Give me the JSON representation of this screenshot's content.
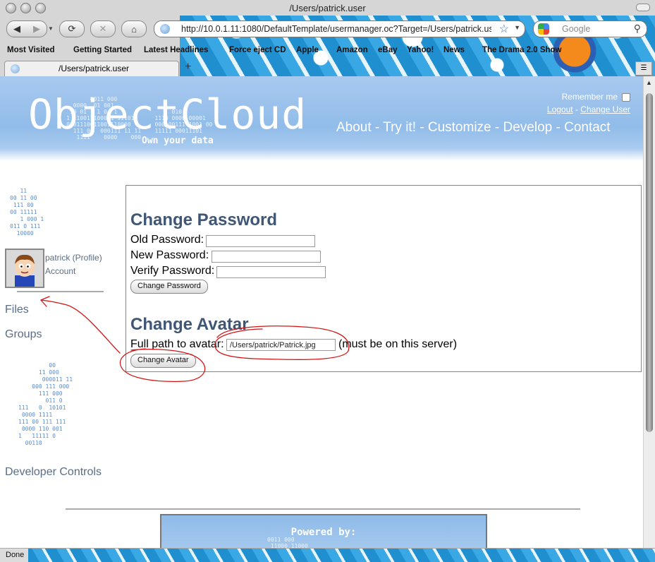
{
  "window": {
    "title": "/Users/patrick.user"
  },
  "toolbar": {
    "url": "http://10.0.1.11:1080/DefaultTemplate/usermanager.oc?Target=/Users/patrick.user",
    "search_placeholder": "Google"
  },
  "bookmarks": [
    "Most Visited",
    "Getting Started",
    "Latest Headlines",
    "Force eject CD",
    "Apple",
    "Amazon",
    "eBay",
    "Yahoo!",
    "News",
    "The Drama 2.0 Show"
  ],
  "tabs": [
    {
      "label": "/Users/patrick.user",
      "active": true
    }
  ],
  "header": {
    "logo": "ObjectCloud",
    "tagline": "Own your data",
    "remember_me": "Remember me",
    "logout": "Logout",
    "separator": " - ",
    "change_user": "Change User",
    "nav": "About - Try it! - Customize - Develop - Contact"
  },
  "sidebar": {
    "profile_link": "patrick (Profile)",
    "account_link": "Account",
    "files": "Files",
    "groups": "Groups",
    "developer_controls": "Developer Controls"
  },
  "change_password": {
    "title": "Change Password",
    "old_label": "Old Password:",
    "new_label": "New Password:",
    "verify_label": "Verify Password:",
    "button": "Change Password"
  },
  "change_avatar": {
    "title": "Change Avatar",
    "path_label": "Full path to avatar:",
    "path_value": "/Users/patrick/Patrick.jpg",
    "note": "(must be on this server)",
    "button": "Change Avatar"
  },
  "footer": {
    "powered_by": "Powered by:"
  },
  "status": {
    "text": "Done"
  },
  "colors": {
    "header_blue": "#91bce9",
    "title_blue": "#3f5674",
    "annotation_red": "#d41414"
  }
}
